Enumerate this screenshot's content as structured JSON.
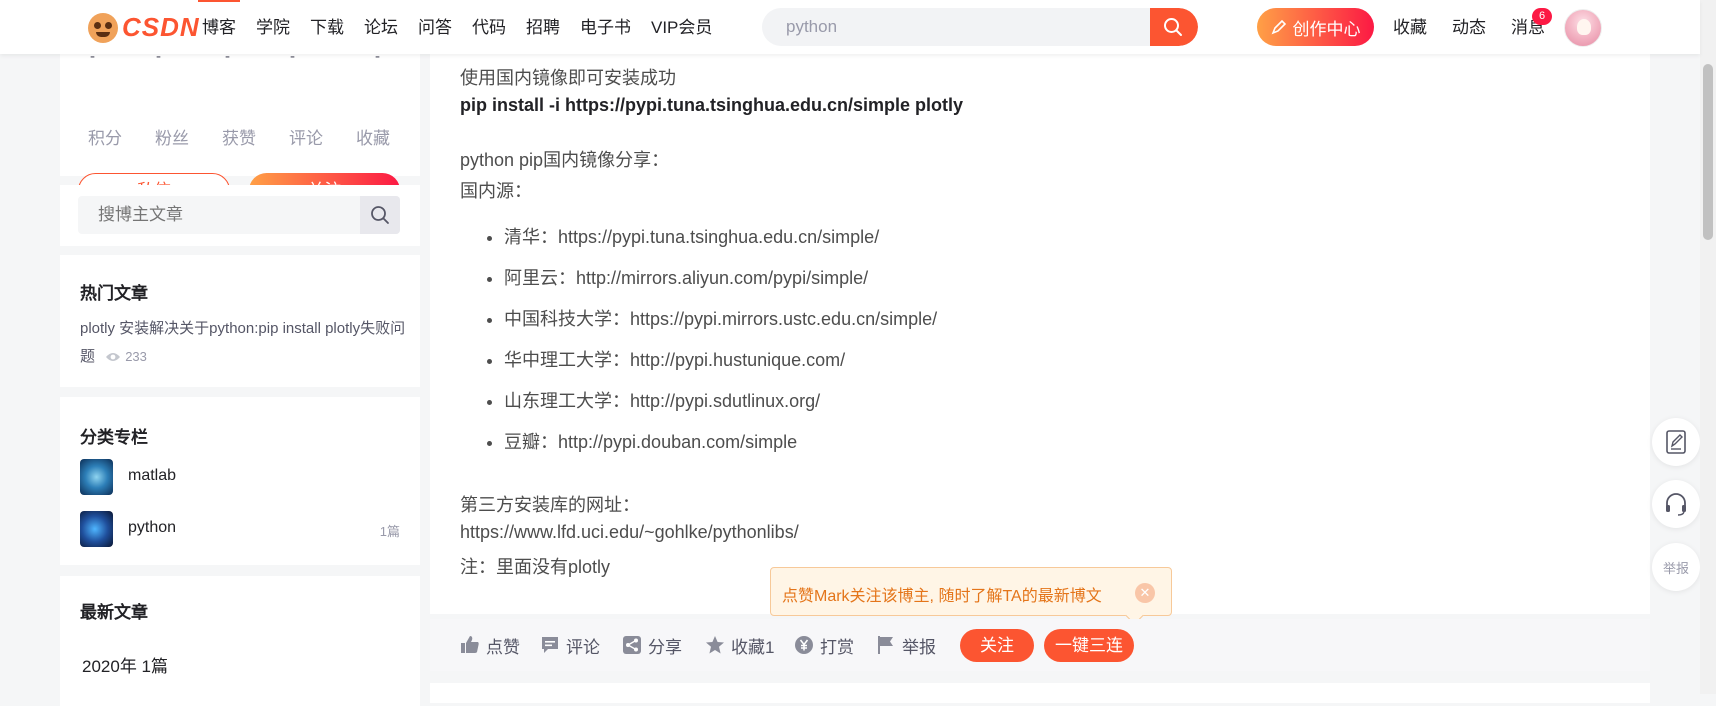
{
  "header": {
    "logo_text": "CSDN",
    "nav": [
      "博客",
      "学院",
      "下载",
      "论坛",
      "问答",
      "代码",
      "招聘",
      "电子书",
      "VIP会员"
    ],
    "search_value": "python",
    "create_label": "创作中心",
    "links": [
      "收藏",
      "动态",
      "消息"
    ],
    "message_count": "6"
  },
  "sidebar": {
    "stats": [
      "积分",
      "粉丝",
      "获赞",
      "评论",
      "收藏"
    ],
    "message_button": "私信",
    "follow_button": "关注",
    "search_placeholder": "搜博主文章",
    "hot_title": "热门文章",
    "hot_article": "plotly 安装解决关于python:pip install plotly失败问题",
    "hot_views": "233",
    "category_title": "分类专栏",
    "categories": [
      {
        "name": "matlab",
        "count": ""
      },
      {
        "name": "python",
        "count": "1篇"
      }
    ],
    "latest_title": "最新文章",
    "archive": "2020年  1篇"
  },
  "article": {
    "p1": "使用国内镜像即可安装成功",
    "command": "pip install -i https://pypi.tuna.tsinghua.edu.cn/simple plotly",
    "p2": "python pip国内镜像分享：",
    "p3": "国内源：",
    "mirrors": [
      "清华：https://pypi.tuna.tsinghua.edu.cn/simple/",
      "阿里云：http://mirrors.aliyun.com/pypi/simple/",
      "中国科技大学：https://pypi.mirrors.ustc.edu.cn/simple/",
      "华中理工大学：http://pypi.hustunique.com/",
      "山东理工大学：http://pypi.sdutlinux.org/",
      "豆瓣：http://pypi.douban.com/simple"
    ],
    "p4": "第三方安装库的网址：",
    "p5": "https://www.lfd.uci.edu/~gohlke/pythonlibs/",
    "p6": "注：里面没有plotly"
  },
  "tooltip": {
    "text": "点赞Mark关注该博主, 随时了解TA的最新博文"
  },
  "toolbar": {
    "like": "点赞",
    "comment": "评论",
    "share": "分享",
    "collect": "收藏1",
    "reward": "打赏",
    "report": "举报",
    "follow": "关注",
    "triple": "一键三连"
  },
  "float": {
    "report": "举报"
  },
  "colors": {
    "brand": "#fc5531",
    "gradient_start": "#ffa046",
    "gradient_end": "#fc1944"
  }
}
